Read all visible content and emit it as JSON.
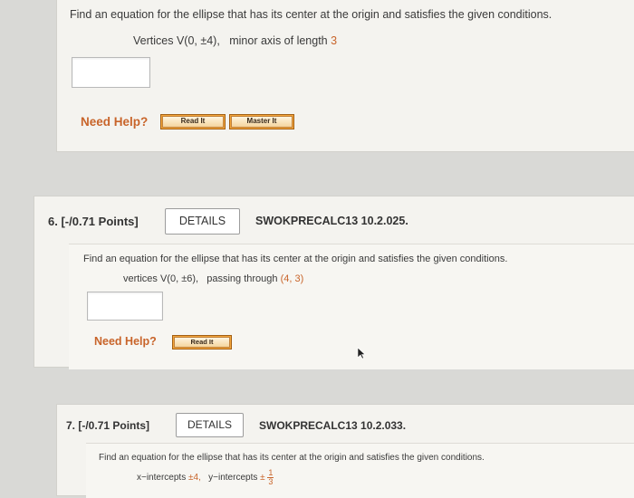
{
  "q5": {
    "prompt": "Find an equation for the ellipse that has its center at the origin and satisfies the given conditions.",
    "vertices_label": "Vertices",
    "vertices_value": "V(0, ±4),",
    "minor_label": "minor axis of length",
    "minor_value": "3",
    "need_help": "Need Help?",
    "read_it": "Read It",
    "master_it": "Master It"
  },
  "q6": {
    "number": "6.",
    "points": "[-/0.71 Points]",
    "details": "DETAILS",
    "code": "SWOKPRECALC13 10.2.025.",
    "prompt": "Find an equation for the ellipse that has its center at the origin and satisfies the given conditions.",
    "vertices_label": "vertices",
    "vertices_value": "V(0, ±6),",
    "passing_label": "passing through",
    "passing_value": "(4, 3)",
    "need_help": "Need Help?",
    "read_it": "Read It"
  },
  "q7": {
    "number": "7.",
    "points": "[-/0.71 Points]",
    "details": "DETAILS",
    "code": "SWOKPRECALC13 10.2.033.",
    "prompt": "Find an equation for the ellipse that has its center at the origin and satisfies the given conditions.",
    "x_label": "x−intercepts",
    "x_value": "±4,",
    "y_label": "y−intercepts",
    "y_sign": "±",
    "y_num": "1",
    "y_den": "3"
  },
  "colors": {
    "accent": "#c8642a",
    "button_orange": "#f3a53a",
    "background": "#d9d9d6",
    "card": "#f4f3ef"
  }
}
